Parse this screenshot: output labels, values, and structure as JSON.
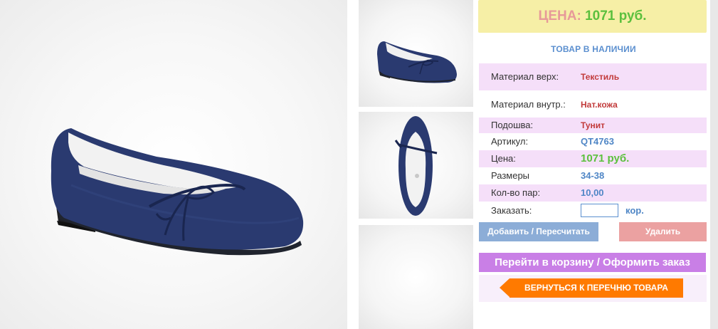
{
  "product": {
    "price_label": "ЦЕНА:",
    "price_value": "1071 руб.",
    "stock_status": "ТОВАР В НАЛИЧИИ",
    "specs": [
      {
        "label": "Материал верх:",
        "value": "Текстиль"
      },
      {
        "label": "Материал внутр.:",
        "value": "Нат.кожа"
      },
      {
        "label": "Подошва:",
        "value": "Тунит"
      },
      {
        "label": "Артикул:",
        "value": "QT4763"
      },
      {
        "label": "Цена:",
        "value": "1071 руб."
      },
      {
        "label": "Размеры",
        "value": "34-38"
      },
      {
        "label": "Кол-во пар:",
        "value": "10,00"
      }
    ],
    "order": {
      "label": "Заказать:",
      "value": "",
      "unit": "кор."
    }
  },
  "actions": {
    "update": "Добавить / Пересчитать",
    "delete": "Удалить",
    "cart": "Перейти в корзину / Оформить заказ",
    "back": "ВЕРНУТЬСЯ К ПЕРЕЧНЮ ТОВАРА"
  },
  "colors": {
    "price_banner": "#f6efa6",
    "stock": "#5b8fcf",
    "cart_button": "#c97fe6",
    "back_button": "#ff7a00"
  }
}
